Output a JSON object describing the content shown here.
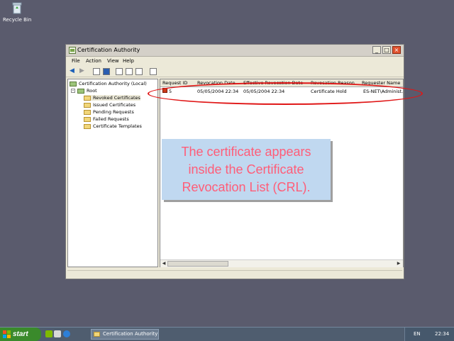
{
  "desktop": {
    "recycle_bin_label": "Recycle Bin"
  },
  "window": {
    "title": "Certification Authority",
    "menus": [
      "File",
      "Action",
      "View",
      "Help"
    ],
    "tree": {
      "root_label": "Certification Authority (Local)",
      "ca_label": "Root",
      "folders": [
        "Revoked Certificates",
        "Issued Certificates",
        "Pending Requests",
        "Failed Requests",
        "Certificate Templates"
      ]
    },
    "list": {
      "columns": [
        "Request ID",
        "Revocation Date",
        "Effective Revocation Date",
        "Revocation Reason",
        "Requester Name"
      ],
      "rows": [
        {
          "request_id": "5",
          "revocation_date": "05/05/2004 22:34",
          "effective_date": "05/05/2004 22:34",
          "reason": "Certificate Hold",
          "requester": "ES-NET\\Administ..."
        }
      ]
    }
  },
  "caption": {
    "line1": "The certificate appears",
    "line2": "inside the Certificate",
    "line3": "Revocation List (CRL)."
  },
  "taskbar": {
    "start_label": "start",
    "task_label": "Certification Authority",
    "language": "EN",
    "clock": "22:34"
  },
  "colors": {
    "annotation": "#e01616",
    "caption_bg": "#c0d8f0",
    "caption_text": "#ff5d78",
    "desktop": "#5a5b6d"
  }
}
